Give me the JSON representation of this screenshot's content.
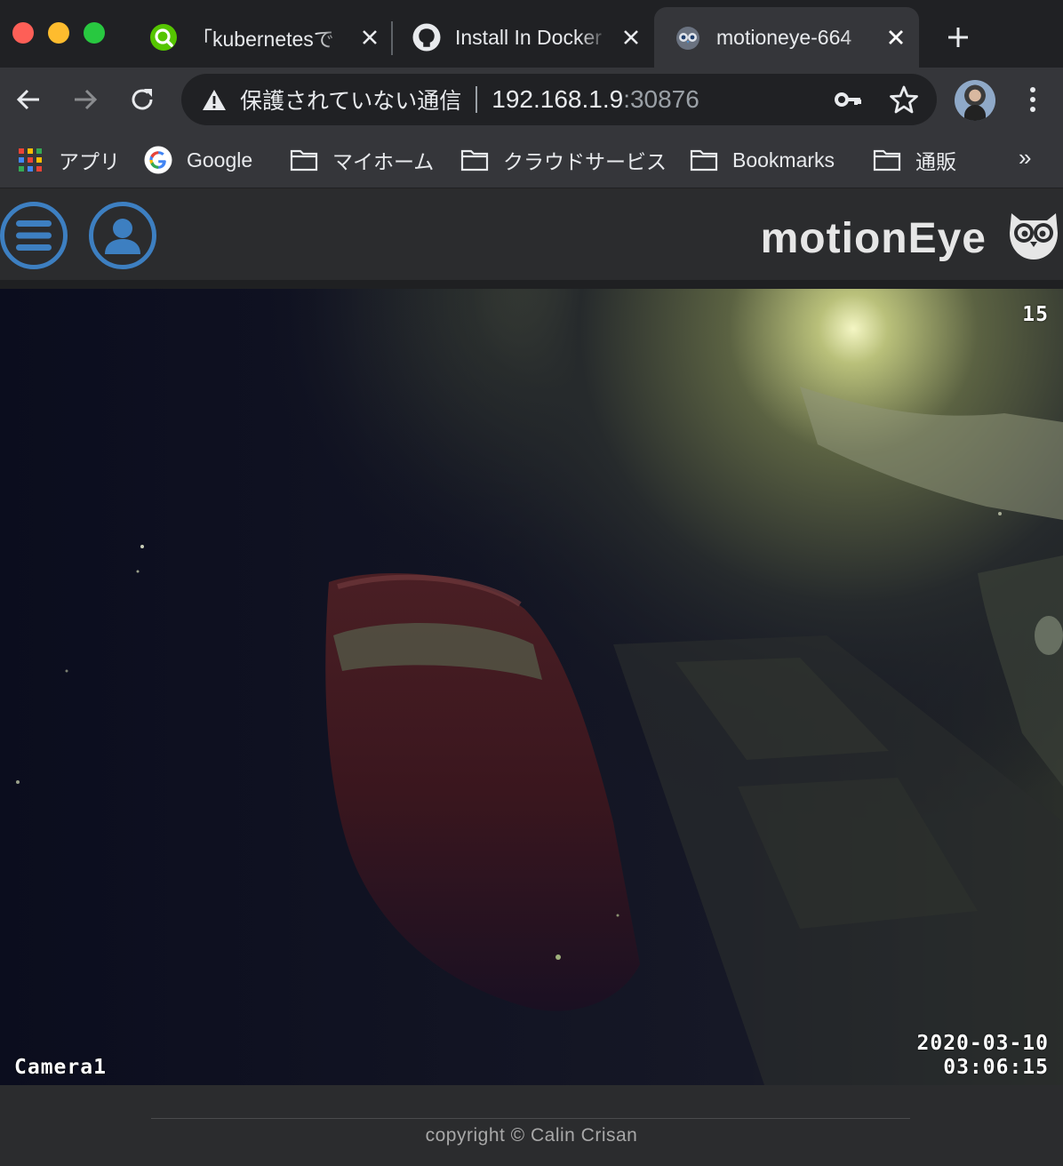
{
  "window": {
    "tabs": [
      {
        "title": "「kubernetesで",
        "favicon": "qiita-search-icon",
        "active": false
      },
      {
        "title": "Install In Docker",
        "favicon": "github-icon",
        "active": false
      },
      {
        "title": "motioneye-664",
        "favicon": "motioneye-owl-icon",
        "active": true
      }
    ],
    "new_tab_icon": "plus-icon"
  },
  "toolbar": {
    "security_label": "保護されていない通信",
    "url_host": "192.168.1.9",
    "url_port": ":30876"
  },
  "bookmarks": [
    {
      "label": "アプリ",
      "icon": "apps-grid-icon"
    },
    {
      "label": "Google",
      "icon": "google-icon"
    },
    {
      "label": "マイホーム",
      "icon": "folder-icon"
    },
    {
      "label": "クラウドサービス",
      "icon": "folder-icon"
    },
    {
      "label": "Bookmarks",
      "icon": "folder-icon"
    },
    {
      "label": "通販",
      "icon": "folder-icon"
    }
  ],
  "bookmarks_more": "»",
  "app": {
    "title": "motionEye",
    "accent_color": "#3d7fc1"
  },
  "camera": {
    "fps": "15",
    "name": "Camera1",
    "date": "2020-03-10",
    "time": "03:06:15"
  },
  "footer": {
    "copyright": "copyright © Calin Crisan"
  }
}
